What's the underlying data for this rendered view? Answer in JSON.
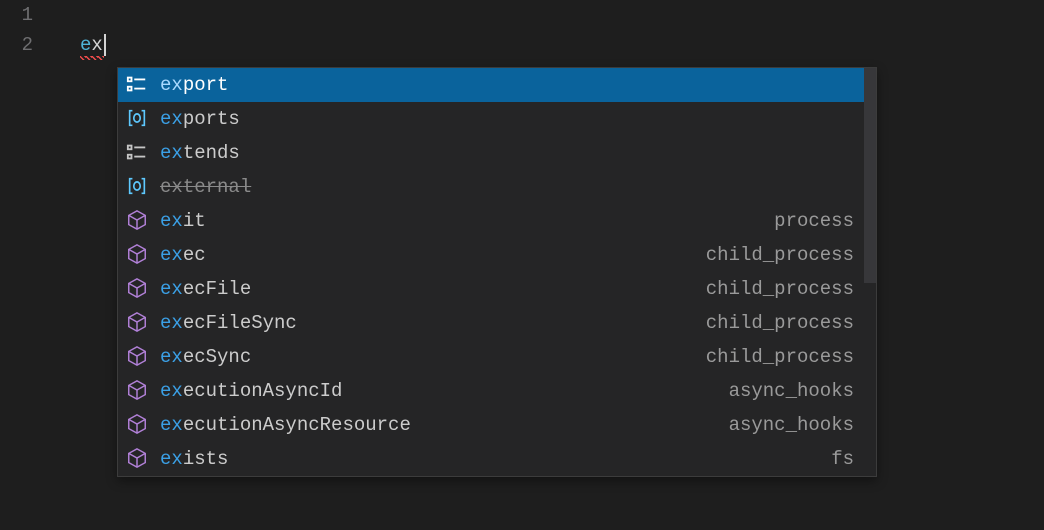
{
  "gutter": {
    "lines": [
      "1",
      "2"
    ]
  },
  "editor": {
    "typed_prefix": "e",
    "typed_rest": "x"
  },
  "suggest": {
    "scrollbar_visible": true,
    "items": [
      {
        "icon": "keyword",
        "match": "ex",
        "rest": "port",
        "source": "",
        "selected": true,
        "deprecated": false
      },
      {
        "icon": "variable",
        "match": "ex",
        "rest": "ports",
        "source": "",
        "selected": false,
        "deprecated": false
      },
      {
        "icon": "keyword",
        "match": "ex",
        "rest": "tends",
        "source": "",
        "selected": false,
        "deprecated": false
      },
      {
        "icon": "variable",
        "match": "ex",
        "rest": "ternal",
        "source": "",
        "selected": false,
        "deprecated": true
      },
      {
        "icon": "method",
        "match": "ex",
        "rest": "it",
        "source": "process",
        "selected": false,
        "deprecated": false
      },
      {
        "icon": "method",
        "match": "ex",
        "rest": "ec",
        "source": "child_process",
        "selected": false,
        "deprecated": false
      },
      {
        "icon": "method",
        "match": "ex",
        "rest": "ecFile",
        "source": "child_process",
        "selected": false,
        "deprecated": false
      },
      {
        "icon": "method",
        "match": "ex",
        "rest": "ecFileSync",
        "source": "child_process",
        "selected": false,
        "deprecated": false
      },
      {
        "icon": "method",
        "match": "ex",
        "rest": "ecSync",
        "source": "child_process",
        "selected": false,
        "deprecated": false
      },
      {
        "icon": "method",
        "match": "ex",
        "rest": "ecutionAsyncId",
        "source": "async_hooks",
        "selected": false,
        "deprecated": false
      },
      {
        "icon": "method",
        "match": "ex",
        "rest": "ecutionAsyncResource",
        "source": "async_hooks",
        "selected": false,
        "deprecated": false
      },
      {
        "icon": "method",
        "match": "ex",
        "rest": "ists",
        "source": "fs",
        "selected": false,
        "deprecated": false
      }
    ]
  }
}
